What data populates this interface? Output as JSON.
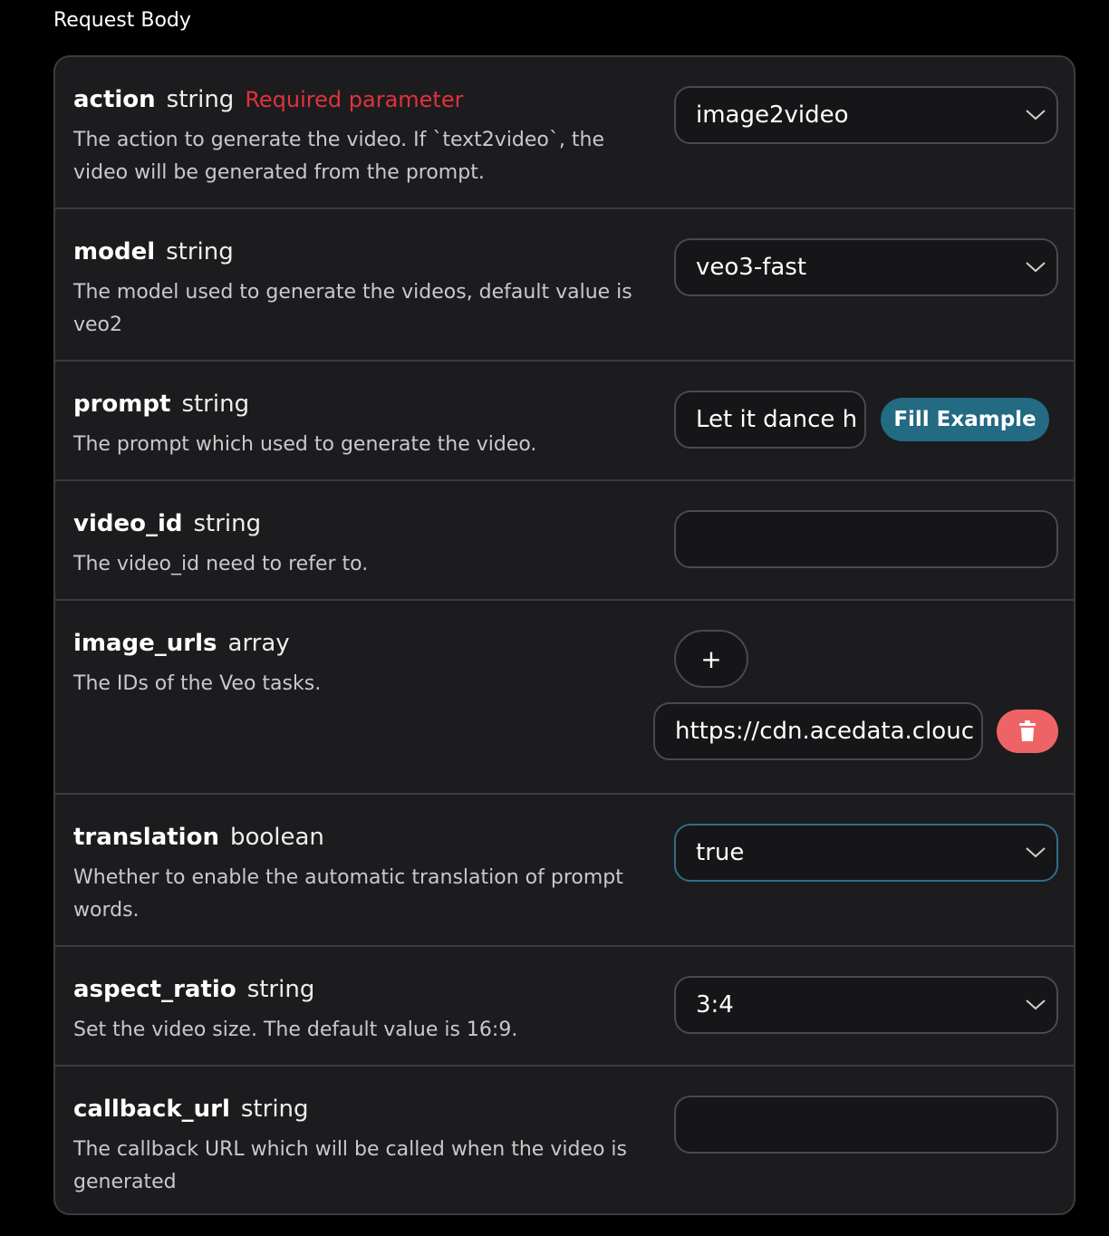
{
  "section": {
    "title": "Request Body"
  },
  "colors": {
    "required": "#e0323c",
    "fill_button": "#236a83",
    "delete_button": "#ee6466",
    "focus_border": "#2f6e86"
  },
  "params": {
    "action": {
      "name": "action",
      "type": "string",
      "required": "Required parameter",
      "description": "The action to generate the video. If `text2video`, the video will be generated from the prompt.",
      "value": "image2video"
    },
    "model": {
      "name": "model",
      "type": "string",
      "description": "The model used to generate the videos, default value is veo2",
      "value": "veo3-fast"
    },
    "prompt": {
      "name": "prompt",
      "type": "string",
      "description": "The prompt which used to generate the video.",
      "value": "Let it dance h",
      "fill_example_label": "Fill Example"
    },
    "video_id": {
      "name": "video_id",
      "type": "string",
      "description": "The video_id need to refer to.",
      "value": ""
    },
    "image_urls": {
      "name": "image_urls",
      "type": "array",
      "description": "The IDs of the Veo tasks.",
      "add_label": "+",
      "items": [
        "https://cdn.acedata.clouc"
      ]
    },
    "translation": {
      "name": "translation",
      "type": "boolean",
      "description": "Whether to enable the automatic translation of prompt words.",
      "value": "true"
    },
    "aspect_ratio": {
      "name": "aspect_ratio",
      "type": "string",
      "description": "Set the video size. The default value is 16:9.",
      "value": "3:4"
    },
    "callback_url": {
      "name": "callback_url",
      "type": "string",
      "description": "The callback URL which will be called when the video is generated",
      "value": ""
    }
  },
  "icons": {
    "dropdown": "chevron-down-icon",
    "delete": "trash-icon",
    "add": "plus-icon"
  }
}
